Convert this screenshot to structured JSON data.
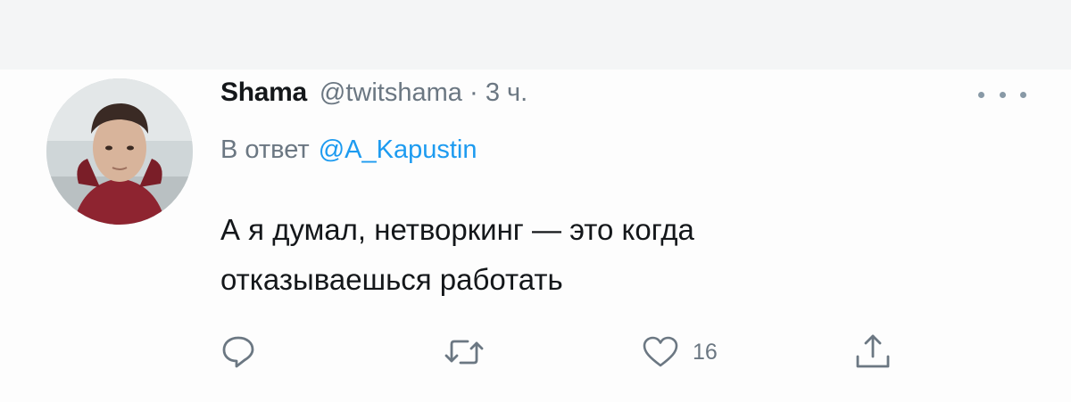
{
  "tweet": {
    "display_name": "Shama",
    "handle": "@twitshama",
    "separator": "·",
    "time": "3 ч.",
    "reply_prefix": "В ответ",
    "reply_to": "@A_Kapustin",
    "text_line1": "А я думал, нетворкинг — это когда",
    "text_line2": "отказываешься работать"
  },
  "actions": {
    "reply_icon": "reply-icon",
    "retweet_icon": "retweet-icon",
    "like_icon": "heart-icon",
    "like_count": "16",
    "share_icon": "share-icon"
  },
  "colors": {
    "link": "#1d9bf0",
    "muted": "#6b7782",
    "text": "#14171a"
  }
}
